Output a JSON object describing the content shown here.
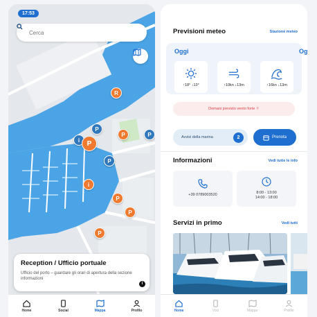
{
  "left": {
    "status_time": "17:53",
    "search": {
      "placeholder": "Cerca"
    },
    "pins": {
      "p1": "R",
      "p2": "P",
      "p3": "i",
      "p4": "P",
      "p5": "P",
      "p6": "P",
      "p7": "P",
      "p8": "i",
      "p9": "P",
      "p10": "P",
      "p11": "P"
    },
    "card": {
      "title": "Reception / Ufficio portuale",
      "description": "Ufficio del porto – guardare gli orari di apertura della sezione informazioni"
    },
    "nav": [
      {
        "label": "Home",
        "icon": "home-icon"
      },
      {
        "label": "Social",
        "icon": "phone-icon"
      },
      {
        "label": "Mappa",
        "icon": "map-icon"
      },
      {
        "label": "Profilo",
        "icon": "user-icon"
      }
    ]
  },
  "right": {
    "weather": {
      "title": "Previsioni meteo",
      "link": "Stazione meteo",
      "day": "Oggi",
      "next_day": "Og",
      "temp": "↑18° ↓13°",
      "wind": "↑10kn ↓13m",
      "waves": "↑16kn ↓13m"
    },
    "alert": "Domani previsto vento forte ⚐",
    "buttons": {
      "reviews": "Avvisi della marina",
      "reviews_count": "2",
      "action": "Prenota"
    },
    "info": {
      "title": "Informazioni",
      "link": "Vedi tutte le info",
      "phone": "+39 0789003520",
      "hours_line1": "8:00 - 13:00",
      "hours_line2": "14:00 - 18:00"
    },
    "services": {
      "title": "Servizi in primo",
      "link": "Vedi tutti"
    },
    "nav": [
      {
        "label": "Home",
        "icon": "home-icon"
      },
      {
        "label": "Voci",
        "icon": "phone-icon"
      },
      {
        "label": "Mappa",
        "icon": "map-icon"
      },
      {
        "label": "Profilo",
        "icon": "user-icon"
      }
    ]
  },
  "colors": {
    "primary": "#1f6fd1",
    "water": "#4aa4e6",
    "pin_orange": "#f07a2f",
    "pin_blue": "#2f78bd",
    "alert": "#d8404a"
  }
}
